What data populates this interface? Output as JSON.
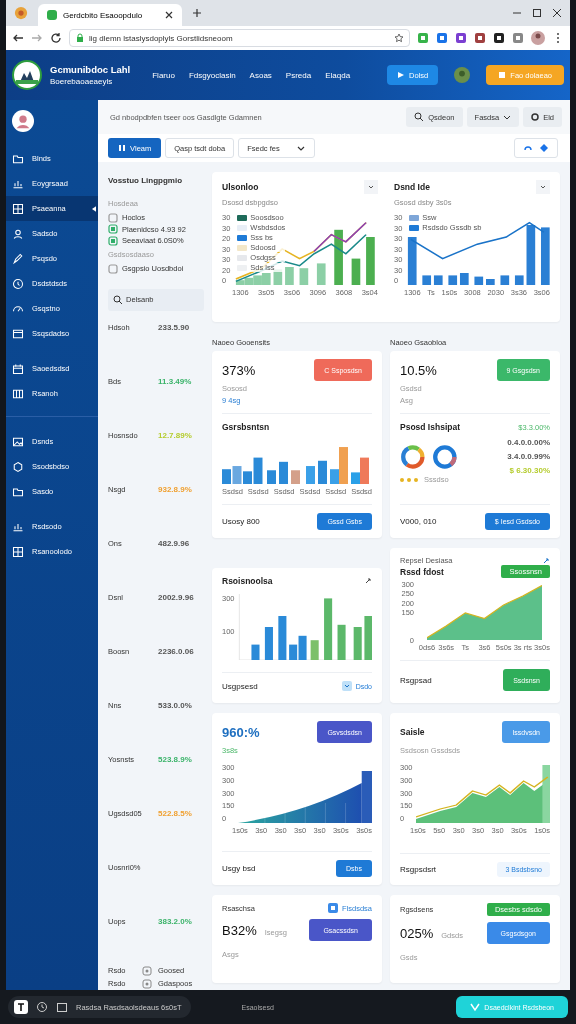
{
  "browser": {
    "tab_title": "Gerdcbito Esaoopdulo",
    "url": "lig dlemn lstaslysdoplyls Gorstlidsneoom"
  },
  "header": {
    "title": "Gcmunibdoc Lahl",
    "subtitle": "Boerebaoaeaeyls",
    "nav": [
      "Flaruo",
      "Fdsgyoclasin",
      "Asoas",
      "Psreda",
      "Elaqda"
    ],
    "primary_button": "Dolsd",
    "accent_button": "Fao dolaeao"
  },
  "sidebar": {
    "groups": [
      [
        {
          "label": "Blnds",
          "selected": false
        },
        {
          "label": "Eoygrsaad",
          "selected": false
        },
        {
          "label": "Psaeanna",
          "selected": true
        },
        {
          "label": "Sadsdo",
          "selected": false
        },
        {
          "label": "Psqsdo",
          "selected": false
        },
        {
          "label": "Dsdstdsds",
          "selected": false
        },
        {
          "label": "Gsqstno",
          "selected": false
        },
        {
          "label": "Ssqsdadso",
          "selected": false
        }
      ],
      [
        {
          "label": "Saoedsdsd",
          "selected": false
        },
        {
          "label": "Rsanoh",
          "selected": false
        }
      ],
      [
        {
          "label": "Dsnds",
          "selected": false
        },
        {
          "label": "Ssodsbdso",
          "selected": false
        },
        {
          "label": "Sasdo",
          "selected": false
        }
      ],
      [
        {
          "label": "Rsdsodo",
          "selected": false
        },
        {
          "label": "Rsanoolodo",
          "selected": false
        }
      ]
    ]
  },
  "toolbar": {
    "breadcrumb": "Gd nbodpdbfen tseer oos Gasdlgte Gdamnen",
    "search_button": "Qsdeon",
    "filter_dropdown": "Fasdsa",
    "edit_button": "Eld",
    "view_button": "Vleam",
    "secondary_button": "Qasp tsdt doba",
    "select": "Fsedc fes"
  },
  "filters_panel": {
    "title": "Vosstuo Lingpgmio",
    "items": [
      {
        "kind": "heading",
        "label": "Hosdeaa"
      },
      {
        "kind": "option",
        "label": "Hoclos",
        "checked": false
      },
      {
        "kind": "option",
        "label": "Plaenidcso 4.93 92",
        "checked": true
      },
      {
        "kind": "option",
        "label": "Seeaviaat 6.0S0%",
        "checked": true
      },
      {
        "kind": "heading",
        "label": "Gsdsosdaaso"
      },
      {
        "kind": "option",
        "label": "Gsgpsio Uosdbdoi",
        "checked": false
      }
    ],
    "search_placeholder": "Delsanb",
    "rows": [
      {
        "label": "Hdsoh",
        "value": "233.5.90",
        "color": "#555555"
      },
      {
        "label": "Bds",
        "value": "11.3.49%",
        "color": "#3bb36a"
      },
      {
        "label": "Hosnsdo",
        "value": "12.7.89%",
        "color": "#b5cc2e"
      },
      {
        "label": "Nsgd",
        "value": "932.8.9%",
        "color": "#f0a030"
      },
      {
        "label": "Ons",
        "value": "482.9.96",
        "color": "#555555"
      },
      {
        "label": "Dsnl",
        "value": "2002.9.96",
        "color": "#555555"
      },
      {
        "label": "Boosn",
        "value": "2236.0.06",
        "color": "#555555"
      },
      {
        "label": "Nns",
        "value": "533.0.0%",
        "color": "#555555"
      },
      {
        "label": "Yosnsts",
        "value": "523.8.9%",
        "color": "#3bb36a"
      },
      {
        "label": "Ugsdsd05",
        "value": "522.8.5%",
        "color": "#f0a030"
      },
      {
        "label": "Uosnri0%"
      },
      {
        "label": "Uops",
        "value": "383.2.0%",
        "color": "#3bb36a"
      }
    ],
    "footer_rows": [
      {
        "label": "Rsdo",
        "value": "Goosed"
      },
      {
        "label": "Rsdo",
        "value": "Gdaspoos"
      }
    ]
  },
  "overview": [
    {
      "title": "Ulsonloo",
      "subtitle": "Dsosd dsbpgdso",
      "legend": [
        {
          "label": "Soosdsoo",
          "color": "#1e6b5a"
        },
        {
          "label": "Wsbdsdos",
          "color": "#e8eef6"
        },
        {
          "label": "Sss bs",
          "color": "#1e7ad6"
        },
        {
          "label": "Sdoosd",
          "color": "#f3e7c8"
        },
        {
          "label": "Osdgss",
          "color": "#e6e8ec"
        },
        {
          "label": "Sds lss",
          "color": "#eef0f2"
        }
      ],
      "y_labels": [
        "30",
        "30",
        "20",
        "30",
        "30",
        "20",
        "0"
      ],
      "x_labels": [
        "1306",
        "3s05",
        "3s06",
        "3096",
        "3608",
        "3s04"
      ]
    },
    {
      "title": "Dsnd Ide",
      "subtitle": "Gsosd dsby 3s0s",
      "legend": [
        {
          "label": "Ssw",
          "color": "#7ea6d8"
        },
        {
          "label": "Rsdsdo  Gssdb sb",
          "color": "#1e7ad6"
        }
      ],
      "y_labels": [
        "30",
        "30",
        "30",
        "30",
        "30",
        "30",
        "0"
      ],
      "x_labels": [
        "1306",
        "Ts",
        "1s0s",
        "3008",
        "2030",
        "3s36",
        "3s06"
      ]
    }
  ],
  "section_labels": [
    "Naoeo Gooensits",
    "Naoeo Gsaobloa"
  ],
  "stat_cards": [
    {
      "value": "373%",
      "button": "C Ssposdsn",
      "color": "#ef6a5a",
      "note": "Sososd",
      "delta": "9 4sg",
      "chart_title": "Gsrsbsntsn",
      "x_labels": [
        "Ssdsd",
        "Ssdsd",
        "Ssdsd",
        "Ssdsd",
        "Ssdsd",
        "Ssdsd"
      ],
      "footer": "Usosy 800",
      "footer_button": "Gssd Gsbs"
    },
    {
      "value": "10.5%",
      "button": "9 Gsgsdsn",
      "color": "#3bb86a",
      "note": "Gsdsd",
      "delta": "Asg",
      "chart_title": "Psosd Ishsipat",
      "headline": "$3.3.00%",
      "values": [
        {
          "text": "0.4.0.0.00%",
          "color": "#555555"
        },
        {
          "text": "3.4.0.0.99%",
          "color": "#555555"
        },
        {
          "text": "$ 6.30.30%",
          "color": "#b5cc2e"
        }
      ],
      "legend": "Sssdso",
      "footer": "V000, 010",
      "footer_button": "$ Iesd Gsdsdo"
    }
  ],
  "bar_card": {
    "title": "Rsoisnoolsa",
    "y_labels": [
      "300",
      "100"
    ],
    "footer": "Usgpsesd",
    "link": "Dsdo"
  },
  "area_card": {
    "label": "Repsel Desiasa",
    "title": "Rssd fdost",
    "badge": "Ssossnsn",
    "chart_data": {
      "type": "area",
      "categories": [
        "0ds6",
        "3s6s",
        "Ts",
        "3s6",
        "5s0s",
        "3s rts",
        "3s0s"
      ],
      "ylim": [
        0,
        300
      ],
      "yticks": [
        0,
        150,
        200,
        250,
        300
      ],
      "series": [
        {
          "color": "#5cc08a",
          "values": [
            12,
            75,
            145,
            115,
            188,
            236,
            292
          ]
        }
      ]
    },
    "footer": "Rsgpsad",
    "footer_button": "Ssdsnsn"
  },
  "growth_cards": [
    {
      "value": "960:%",
      "button": "Gsvsdsdsn",
      "delta": "3s8s",
      "y_labels": [
        "300",
        "300",
        "300",
        "150",
        "0"
      ],
      "x_labels": [
        "1s0s",
        "3s0",
        "3s0",
        "3s0",
        "3s0",
        "3s0s",
        "3s0s"
      ],
      "footer": "Usgy bsd",
      "footer_button": "Dsbs"
    },
    {
      "title": "Saisle",
      "button": "Issdvsdn",
      "subtitle": "Ssdsosn Gssdsds",
      "y_labels": [
        "300",
        "300",
        "300",
        "150",
        "0"
      ],
      "x_labels": [
        "1s0s",
        "5s0",
        "3s0",
        "3s0",
        "3s0",
        "3s0s",
        "1s0s"
      ],
      "footer": "Rsgpsdsrt",
      "footer_button": "3 Bsdsbsno"
    }
  ],
  "summary_cards": [
    {
      "title": "Rsaschsa",
      "link": "Flsdsdsa",
      "value": "B32%",
      "unit": "Isegsg",
      "button": "Gsacssdsn",
      "note": "Asgs"
    },
    {
      "title": "Rgsdsens",
      "badge": "Dsesbs sdsdo",
      "value": "025%",
      "unit": "Gdsds",
      "button": "Gsgsdsgon",
      "note": "Gsds"
    }
  ],
  "taskbar": {
    "window_label": "Rasdsa Rasdsaolsdeaus 6s0sT",
    "center_label": "Esaolsesd",
    "action_button": "Dsaedclkint Rsdsbeon"
  }
}
